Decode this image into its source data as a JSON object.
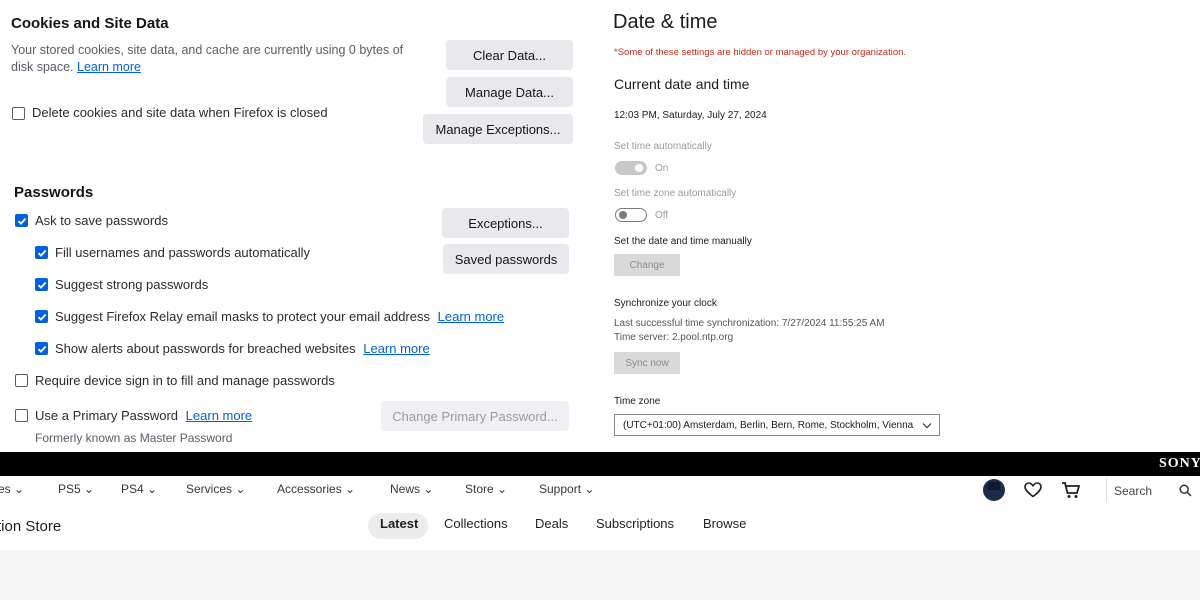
{
  "firefox": {
    "cookies": {
      "title": "Cookies and Site Data",
      "description_line1": "Your stored cookies, site data, and cache are currently using 0 bytes of",
      "description_line2": "disk space.",
      "learn_more": "Learn more",
      "delete_on_close": "Delete cookies and site data when Firefox is closed",
      "clear_data_button": "Clear Data...",
      "manage_data_button": "Manage Data...",
      "manage_exceptions_button": "Manage Exceptions..."
    },
    "passwords": {
      "title": "Passwords",
      "ask_to_save": "Ask to save passwords",
      "fill_auto": "Fill usernames and passwords automatically",
      "suggest_strong": "Suggest strong passwords",
      "suggest_relay": "Suggest Firefox Relay email masks to protect your email address",
      "relay_learn_more": "Learn more",
      "show_alerts": "Show alerts about passwords for breached websites",
      "alerts_learn_more": "Learn more",
      "require_device": "Require device sign in to fill and manage passwords",
      "primary_password": "Use a Primary Password",
      "primary_learn_more": "Learn more",
      "formerly_known": "Formerly known as Master Password",
      "exceptions_button": "Exceptions...",
      "saved_passwords_button": "Saved passwords",
      "change_primary_button": "Change Primary Password..."
    }
  },
  "windows": {
    "title": "Date & time",
    "managed_warning": "*Some of these settings are hidden or managed by your organization.",
    "current_heading": "Current date and time",
    "current_value": "12:03 PM, Saturday, July 27, 2024",
    "set_time_auto_label": "Set time automatically",
    "set_time_auto_state": "On",
    "set_zone_auto_label": "Set time zone automatically",
    "set_zone_auto_state": "Off",
    "manual_label": "Set the date and time manually",
    "change_button": "Change",
    "sync_heading": "Synchronize your clock",
    "last_sync": "Last successful time synchronization: 7/27/2024 11:55:25 AM",
    "time_server": "Time server: 2.pool.ntp.org",
    "sync_button": "Sync now",
    "timezone_label": "Time zone",
    "timezone_value": "(UTC+01:00) Amsterdam, Berlin, Bern, Rome, Stockholm, Vienna"
  },
  "sony": {
    "brand": "SONY",
    "nav": [
      "es",
      "PS5",
      "PS4",
      "Services",
      "Accessories",
      "News",
      "Store",
      "Support"
    ],
    "search_label": "Search",
    "store_title": "tion Store",
    "tabs": [
      "Latest",
      "Collections",
      "Deals",
      "Subscriptions",
      "Browse"
    ]
  },
  "colors": {
    "firefox_accent": "#0061e0",
    "warning_red": "#c42b1c",
    "sony_black": "#000000"
  },
  "icons": [
    "checkmark-icon",
    "chevron-down-icon",
    "heart-icon",
    "cart-icon",
    "search-icon",
    "avatar"
  ]
}
